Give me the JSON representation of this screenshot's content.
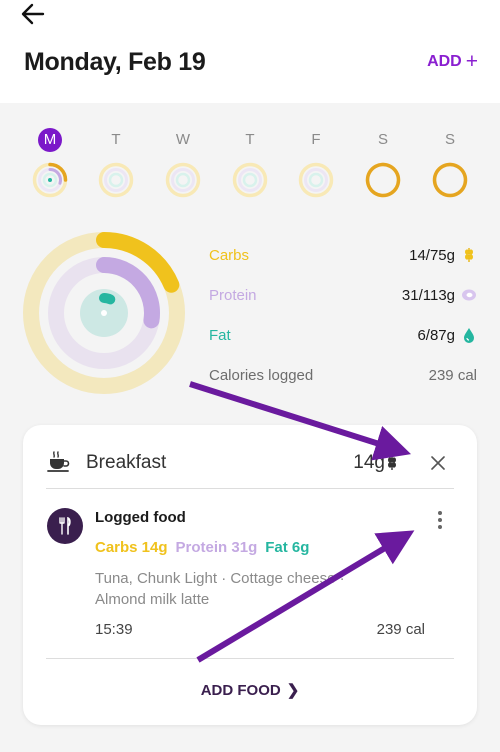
{
  "header": {
    "title": "Monday, Feb 19",
    "add_label": "ADD",
    "add_icon": "plus-icon"
  },
  "week": {
    "days": [
      {
        "letter": "M",
        "selected": true,
        "progress": 0.25
      },
      {
        "letter": "T",
        "selected": false,
        "progress": 0
      },
      {
        "letter": "W",
        "selected": false,
        "progress": 0
      },
      {
        "letter": "T",
        "selected": false,
        "progress": 0
      },
      {
        "letter": "F",
        "selected": false,
        "progress": 0
      },
      {
        "letter": "S",
        "selected": false,
        "progress": 1
      },
      {
        "letter": "S",
        "selected": false,
        "progress": 1
      }
    ]
  },
  "macros": {
    "carbs": {
      "label": "Carbs",
      "value": "14/75g",
      "logged": 14,
      "goal": 75,
      "color": "#f0c21d",
      "icon": "wheat-icon"
    },
    "protein": {
      "label": "Protein",
      "value": "31/113g",
      "logged": 31,
      "goal": 113,
      "color": "#c4a9e2",
      "icon": "meat-icon"
    },
    "fat": {
      "label": "Fat",
      "value": "6/87g",
      "logged": 6,
      "goal": 87,
      "color": "#25b6a0",
      "icon": "drop-icon"
    },
    "calories": {
      "label": "Calories logged",
      "value": "239 cal"
    }
  },
  "meal": {
    "title": "Breakfast",
    "carbs": "14g",
    "entry": {
      "title": "Logged food",
      "carbs": "Carbs 14g",
      "protein": "Protein 31g",
      "fat": "Fat 6g",
      "description": "Tuna, Chunk Light · Cottage cheese · Almond milk latte",
      "time": "15:39",
      "calories": "239 cal"
    },
    "add_food_label": "ADD FOOD"
  },
  "colors": {
    "accent": "#8a1fd0",
    "annotation_arrow": "#6a1a9e"
  }
}
